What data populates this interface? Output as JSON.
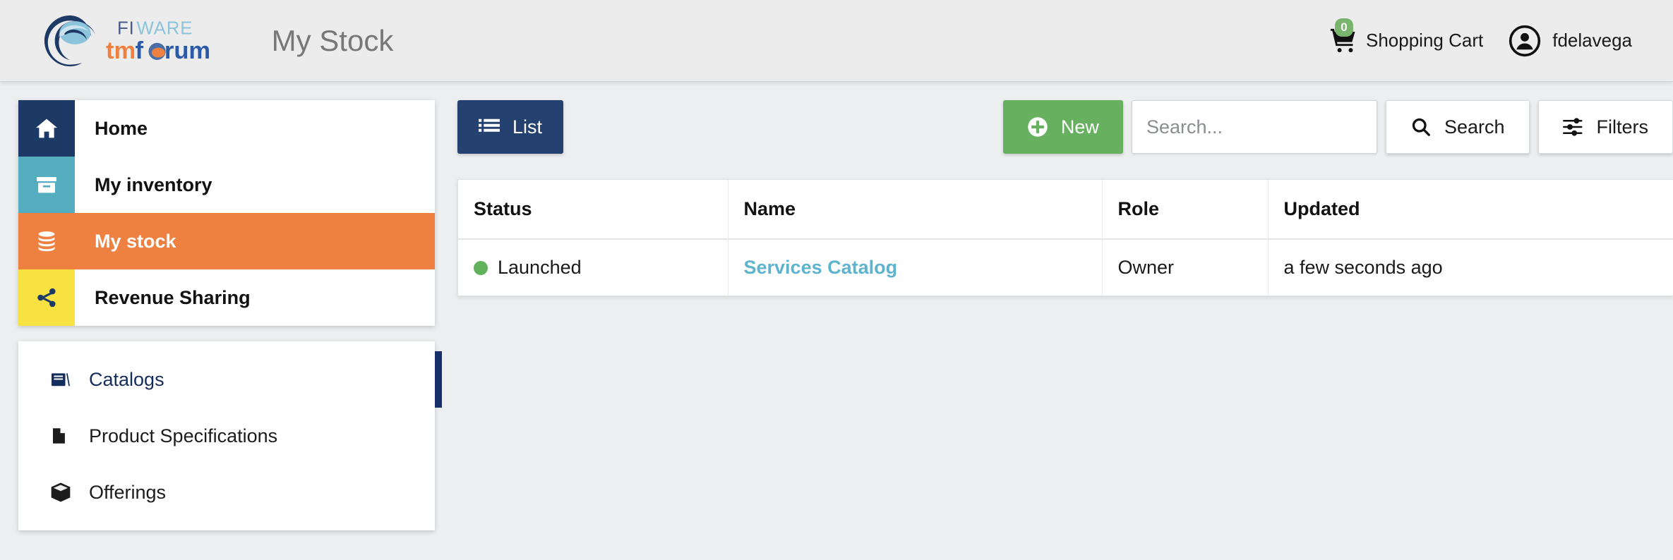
{
  "header": {
    "app_title": "My Stock",
    "logo_alt": "FIWARE tmforum",
    "cart": {
      "label": "Shopping Cart",
      "badge": "0",
      "icon": "shopping-cart-icon"
    },
    "user": {
      "name": "fdelavega",
      "icon": "user-circle-icon"
    }
  },
  "sidebar": {
    "items": [
      {
        "label": "Home",
        "icon": "home-icon",
        "color": "#1d3a66",
        "active": false
      },
      {
        "label": "My inventory",
        "icon": "archive-icon",
        "color": "#55aec0",
        "active": false
      },
      {
        "label": "My stock",
        "icon": "database-icon",
        "color": "#ee8141",
        "active": true
      },
      {
        "label": "Revenue Sharing",
        "icon": "share-icon",
        "color": "#f7e242",
        "active": false
      }
    ],
    "submenu": [
      {
        "label": "Catalogs",
        "icon": "book-icon",
        "active": true
      },
      {
        "label": "Product Specifications",
        "icon": "document-icon",
        "active": false
      },
      {
        "label": "Offerings",
        "icon": "cube-icon",
        "active": false
      }
    ]
  },
  "toolbar": {
    "list_label": "List",
    "list_icon": "list-icon",
    "new_label": "New",
    "new_icon": "plus-circle-icon",
    "search_placeholder": "Search...",
    "search_value": "",
    "search_label": "Search",
    "search_icon": "magnifier-icon",
    "filters_label": "Filters",
    "filters_icon": "sliders-icon"
  },
  "table": {
    "columns": [
      "Status",
      "Name",
      "Role",
      "Updated"
    ],
    "rows": [
      {
        "status": "Launched",
        "status_color": "#62b25d",
        "name": "Services Catalog",
        "role": "Owner",
        "updated": "a few seconds ago"
      }
    ]
  },
  "colors": {
    "brand_navy": "#24416f",
    "accent_orange": "#ee8141",
    "accent_green": "#66b05f",
    "link_teal": "#5eb3cd",
    "page_bg": "#eceef0"
  }
}
